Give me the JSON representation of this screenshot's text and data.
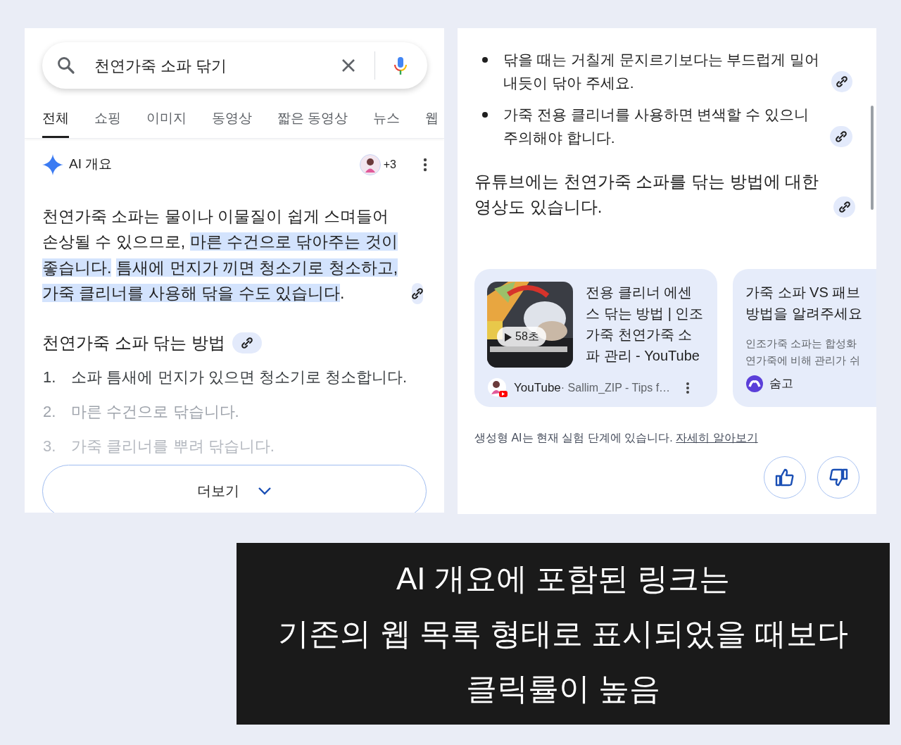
{
  "left_panel": {
    "search": {
      "value": "천연가죽 소파 닦기"
    },
    "tabs": [
      {
        "label": "전체",
        "selected": true
      },
      {
        "label": "쇼핑",
        "selected": false
      },
      {
        "label": "이미지",
        "selected": false
      },
      {
        "label": "동영상",
        "selected": false
      },
      {
        "label": "짧은 동영상",
        "selected": false
      },
      {
        "label": "뉴스",
        "selected": false
      },
      {
        "label": "웹",
        "selected": false
      }
    ],
    "ai_overview": {
      "title": "AI 개요",
      "source_count": "+3",
      "summary": [
        {
          "text": "천연가죽 소파는 물이나 이물질이 쉽게 스며들어 손상될 수 있으므로, ",
          "highlighted": false
        },
        {
          "text": "마른 수건으로 닦아주는 것이 좋습니다.",
          "highlighted": true
        },
        {
          "text": "틈새에 먼지가 끼면 청소기로 청소하고, 가죽 클리너를 사용해 닦을 수도 있습니다",
          "highlighted": true
        },
        {
          "text": ".",
          "highlighted": false
        }
      ],
      "section_heading": "천연가죽 소파 닦는 방법",
      "steps": [
        {
          "number": "1.",
          "text": "소파 틈새에 먼지가 있으면 청소기로 청소합니다.",
          "kind": "visible"
        },
        {
          "number": "2.",
          "text": "마른 수건으로 닦습니다.",
          "kind": "fading"
        },
        {
          "number": "3.",
          "text": "가죽 클리너를 뿌려 닦습니다.",
          "kind": "faint"
        }
      ],
      "more_button": "더보기"
    }
  },
  "right_panel": {
    "bullets": [
      {
        "text": "닦을 때는 거칠게 문지르기보다는 부드럽게 밀어내듯이 닦아 주세요."
      },
      {
        "text": "가죽 전용 클리너를 사용하면 변색할 수 있으니 주의해야 합니다."
      }
    ],
    "paragraph": "유튜브에는 천연가죽 소파를 닦는 방법에 대한 영상도 있습니다.",
    "cards": [
      {
        "kind": "video",
        "duration": "58초",
        "title": "전용 클리너 에센스 닦는 방법 | 인조가죽 천연가죽 소파 관리 - YouTube",
        "source": "YouTube",
        "detail": " · Sallim_ZIP - Tips f…"
      },
      {
        "kind": "article",
        "title_lines": [
          "가죽 소파 VS 패브",
          "방법을 알려주세요"
        ],
        "snippet_lines": [
          "인조가죽 소파는 합성화",
          "연가죽에 비해 관리가 쉬"
        ],
        "source": "숨고"
      }
    ],
    "disclaimer": "생성형 AI는 현재 실험 단계에 있습니다.",
    "learn_more": "자세히 알아보기"
  },
  "caption": {
    "lines": [
      "AI 개요에 포함된 링크는",
      "기존의 웹 목록 형태로 표시되었을 때보다",
      "클릭률이 높음"
    ]
  }
}
